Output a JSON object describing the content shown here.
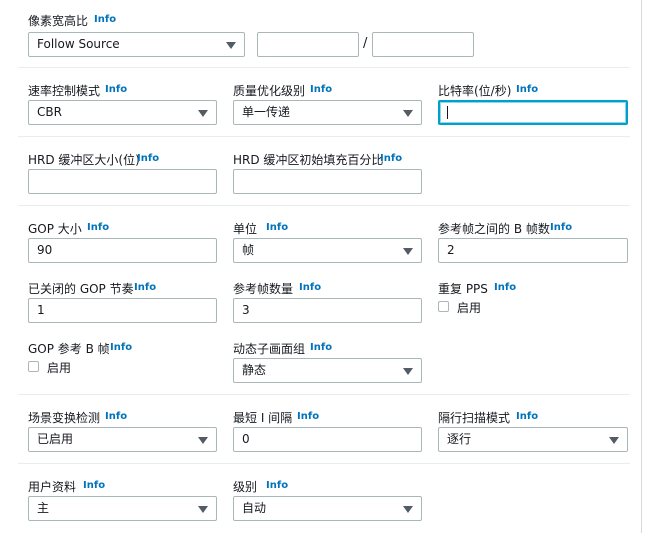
{
  "pixel_aspect": {
    "label": "像素宽高比",
    "info": "Info",
    "select_value": "Follow Source",
    "numerator_value": "",
    "denominator_value": "",
    "separator": "/"
  },
  "rate_control_mode": {
    "label": "速率控制模式",
    "info": "Info",
    "value": "CBR"
  },
  "quality_tuning_level": {
    "label": "质量优化级别",
    "info": "Info",
    "value": "单一传递"
  },
  "bitrate": {
    "label": "比特率(位/秒)",
    "info": "Info",
    "value": ""
  },
  "hrd_buffer_size": {
    "label": "HRD 缓冲区大小(位)",
    "info": "Info",
    "value": ""
  },
  "hrd_buffer_initial_fill": {
    "label": "HRD 缓冲区初始填充百分比",
    "info": "Info",
    "value": ""
  },
  "gop_size": {
    "label": "GOP 大小",
    "info": "Info",
    "value": "90"
  },
  "gop_units": {
    "label": "单位",
    "info": "Info",
    "value": "帧"
  },
  "b_frames_between_ref": {
    "label": "参考帧之间的 B 帧数",
    "info": "Info",
    "value": "2"
  },
  "gop_closed_cadence": {
    "label": "已关闭的 GOP 节奏",
    "info": "Info",
    "value": "1"
  },
  "number_reference_frames": {
    "label": "参考帧数量",
    "info": "Info",
    "value": "3"
  },
  "repeat_pps": {
    "label": "重复 PPS",
    "info": "Info",
    "checkbox_label": "启用"
  },
  "gop_b_reference": {
    "label": "GOP 参考 B 帧",
    "info": "Info",
    "checkbox_label": "启用"
  },
  "dynamic_sub_gop": {
    "label": "动态子画面组",
    "info": "Info",
    "value": "静态"
  },
  "scene_change_detect": {
    "label": "场景变换检测",
    "info": "Info",
    "value": "已启用"
  },
  "min_i_interval": {
    "label": "最短 I 间隔",
    "info": "Info",
    "value": "0"
  },
  "interlace_mode": {
    "label": "隔行扫描模式",
    "info": "Info",
    "value": "逐行"
  },
  "codec_profile": {
    "label": "用户资料",
    "info": "Info",
    "value": "主"
  },
  "codec_level": {
    "label": "级别",
    "info": "Info",
    "value": "自动"
  },
  "colors": {
    "info_link": "#0073bb",
    "focus_border": "#00a1c9",
    "input_border": "#aab7b8"
  }
}
